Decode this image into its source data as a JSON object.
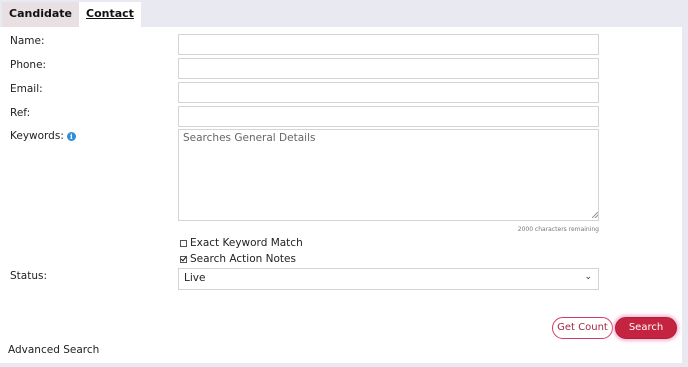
{
  "tabs": [
    {
      "label": "Candidate",
      "active": true
    },
    {
      "label": "Contact",
      "active": false
    }
  ],
  "form": {
    "name_label": "Name:",
    "phone_label": "Phone:",
    "email_label": "Email:",
    "ref_label": "Ref:",
    "keywords_label": "Keywords:",
    "keywords_placeholder": "Searches General Details",
    "chars_remaining": "2000 characters remaining",
    "exact_match_label": "Exact Keyword Match",
    "exact_match_checked": false,
    "action_notes_label": "Search Action Notes",
    "action_notes_checked": true,
    "status_label": "Status:",
    "status_value": "Live"
  },
  "buttons": {
    "get_count": "Get Count",
    "search": "Search"
  },
  "advanced_search": "Advanced Search",
  "colors": {
    "accent": "#c4243f",
    "info_icon": "#2d8fd6",
    "background": "#e9e9f2"
  }
}
